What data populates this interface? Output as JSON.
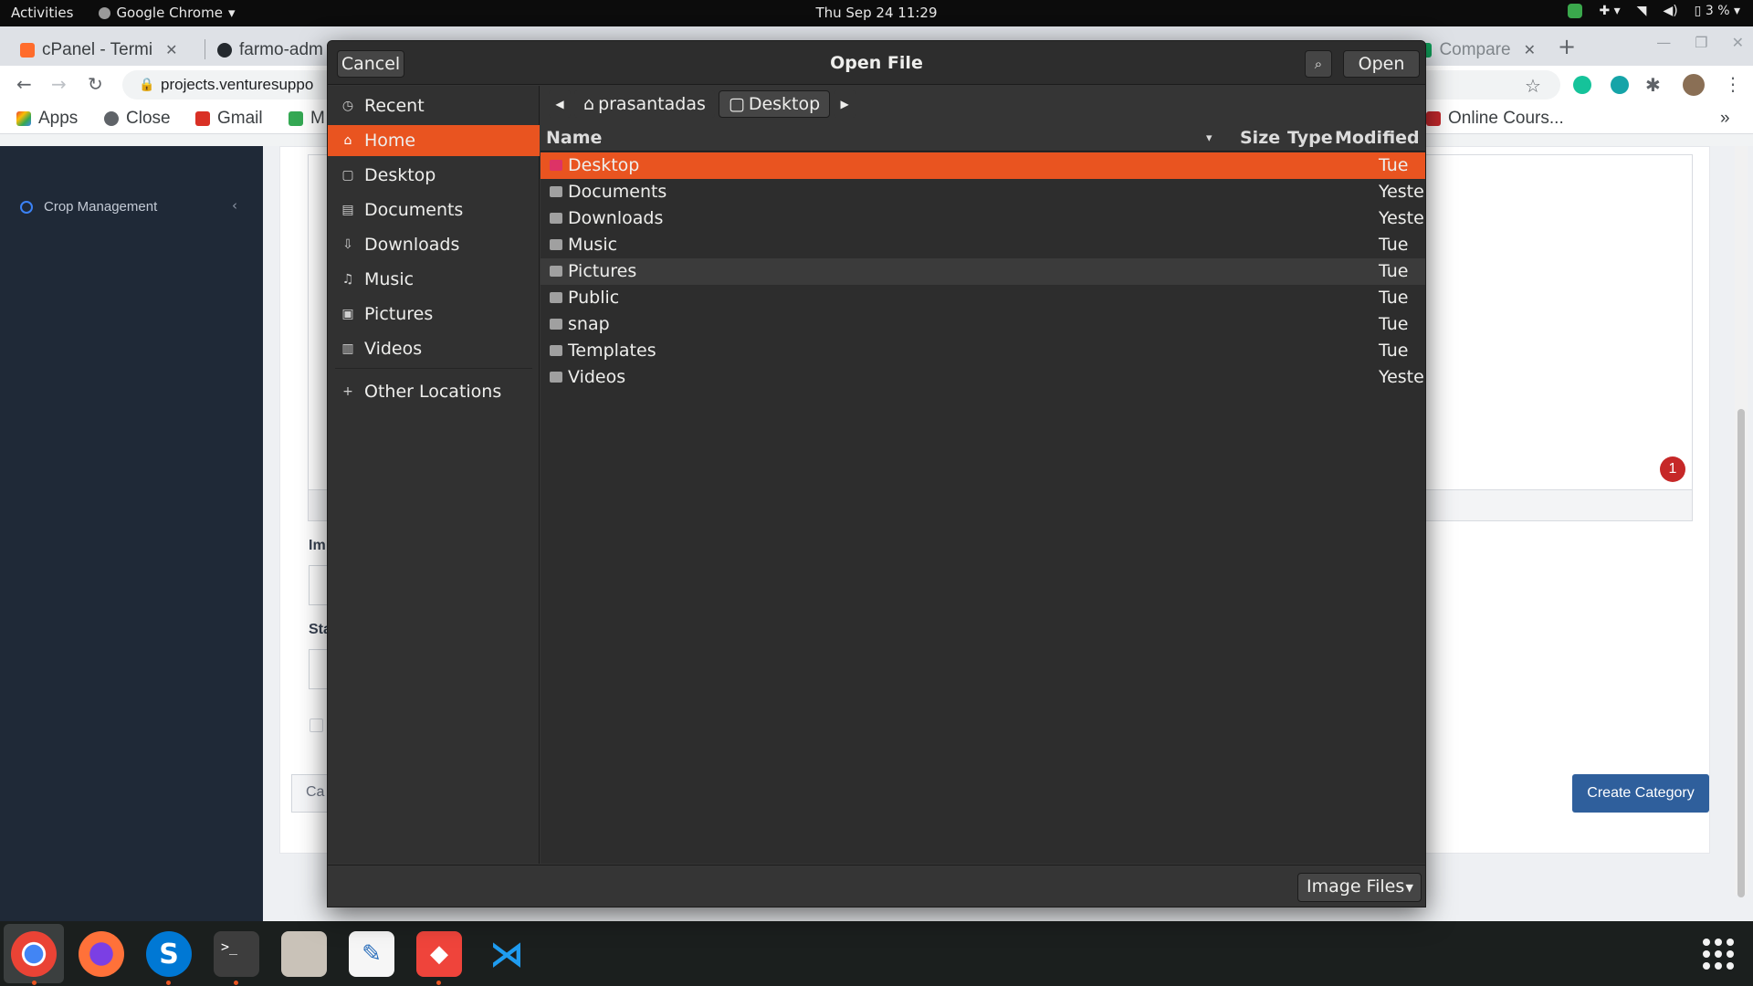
{
  "topbar": {
    "activities": "Activities",
    "app_name": "Google Chrome",
    "clock": "Thu Sep 24  11:29",
    "battery": "3 %"
  },
  "browser": {
    "tabs": [
      {
        "title": "cPanel - Termi",
        "icon": "cpanel-icon"
      },
      {
        "title": "farmo-adm",
        "icon": "github-icon"
      },
      {
        "title": "Compare",
        "icon": "sheets-icon"
      }
    ],
    "url": "projects.venturesuppo",
    "bookmarks": [
      {
        "label": "Apps",
        "icon": "apps-grid-icon"
      },
      {
        "label": "Close",
        "icon": "globe-icon"
      },
      {
        "label": "Gmail",
        "icon": "gmail-icon"
      },
      {
        "label": "M",
        "icon": "maps-icon"
      },
      {
        "label": "Online Cours...",
        "icon": "coursera-icon"
      }
    ],
    "bookmarks_more": "»"
  },
  "page": {
    "sidebar_item": "Crop Management",
    "labels": {
      "images": "Im",
      "status": "Sta"
    },
    "cancel": "Ca",
    "create_button": "Create Category",
    "notification_count": "1"
  },
  "dialog": {
    "title": "Open File",
    "cancel": "Cancel",
    "open": "Open",
    "places": [
      {
        "label": "Recent",
        "icon": "clock-icon",
        "glyph": "◷"
      },
      {
        "label": "Home",
        "icon": "home-icon",
        "glyph": "⌂"
      },
      {
        "label": "Desktop",
        "icon": "desktop-icon",
        "glyph": "▢"
      },
      {
        "label": "Documents",
        "icon": "document-icon",
        "glyph": "▤"
      },
      {
        "label": "Downloads",
        "icon": "download-icon",
        "glyph": "⇩"
      },
      {
        "label": "Music",
        "icon": "music-icon",
        "glyph": "♫"
      },
      {
        "label": "Pictures",
        "icon": "picture-icon",
        "glyph": "▣"
      },
      {
        "label": "Videos",
        "icon": "video-icon",
        "glyph": "▥"
      }
    ],
    "other_locations": "Other Locations",
    "path": {
      "home": "prasantadas",
      "current": "Desktop"
    },
    "columns": {
      "name": "Name",
      "size": "Size",
      "type": "Type",
      "modified": "Modified"
    },
    "files": [
      {
        "name": "Desktop",
        "modified": "Tue"
      },
      {
        "name": "Documents",
        "modified": "Yesterday"
      },
      {
        "name": "Downloads",
        "modified": "Yesterday"
      },
      {
        "name": "Music",
        "modified": "Tue"
      },
      {
        "name": "Pictures",
        "modified": "Tue"
      },
      {
        "name": "Public",
        "modified": "Tue"
      },
      {
        "name": "snap",
        "modified": "Tue"
      },
      {
        "name": "Templates",
        "modified": "Tue"
      },
      {
        "name": "Videos",
        "modified": "Yesterday"
      }
    ],
    "filter": "Image Files"
  },
  "dock": [
    {
      "app": "chrome-icon"
    },
    {
      "app": "firefox-icon"
    },
    {
      "app": "skype-icon"
    },
    {
      "app": "terminal-icon"
    },
    {
      "app": "files-icon"
    },
    {
      "app": "text-editor-icon"
    },
    {
      "app": "anydesk-icon"
    },
    {
      "app": "vscode-icon"
    }
  ],
  "colors": {
    "accent": "#e95420",
    "dialog_bg": "#353535",
    "create_button": "#2f5f9c"
  }
}
